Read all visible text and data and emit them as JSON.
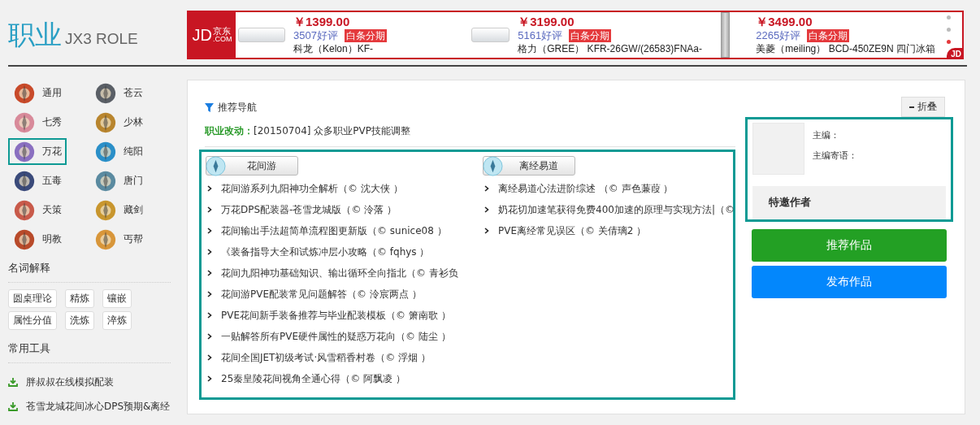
{
  "header": {
    "title": "职业",
    "subtitle": "JX3 ROLE"
  },
  "ad": {
    "logo_main": "JD",
    "logo_cn": "京东",
    "logo_com": ".COM",
    "corner": "JD",
    "items": [
      {
        "price": "￥1399.00",
        "reviews": "3507好评",
        "badge": "白条分期",
        "name": "科龙（Kelon）KF-",
        "kind": "wide"
      },
      {
        "price": "￥3199.00",
        "reviews": "5161好评",
        "badge": "白条分期",
        "name": "格力（GREE） KFR-26GW/(26583)FNAa-",
        "kind": "wide"
      },
      {
        "price": "￥3499.00",
        "reviews": "2265好评",
        "badge": "白条分期",
        "name": "美菱（meiling） BCD-450ZE9N 四门冰箱",
        "kind": "tall"
      }
    ],
    "dots": [
      {
        "selected": false
      },
      {
        "selected": false
      },
      {
        "selected": true
      }
    ]
  },
  "classes": [
    {
      "label": "通用",
      "selected": false
    },
    {
      "label": "苍云",
      "selected": false
    },
    {
      "label": "七秀",
      "selected": false
    },
    {
      "label": "少林",
      "selected": false
    },
    {
      "label": "万花",
      "selected": true
    },
    {
      "label": "纯阳",
      "selected": false
    },
    {
      "label": "五毒",
      "selected": false
    },
    {
      "label": "唐门",
      "selected": false
    },
    {
      "label": "天策",
      "selected": false
    },
    {
      "label": "藏剑",
      "selected": false
    },
    {
      "label": "明教",
      "selected": false
    },
    {
      "label": "丐帮",
      "selected": false
    }
  ],
  "glossary": {
    "title": "名词解释",
    "tags": [
      "圆桌理论",
      "精炼",
      "镶嵌",
      "属性分值",
      "洗炼",
      "淬炼"
    ]
  },
  "tools": {
    "title": "常用工具",
    "items": [
      "胖叔叔在线模拟配装",
      "苍雪龙城花间冰心DPS预期&离经"
    ]
  },
  "nav": {
    "title": "推荐导航",
    "notice_label": "职业改动：",
    "notice_text": "[20150704] 众多职业PVP技能调整"
  },
  "columns": [
    {
      "name": "花间游",
      "articles": [
        "花间游系列九阳神功全解析（© 沈大侠 ）",
        "万花DPS配装器-苍雪龙城版（© 泠落 ）",
        "花间输出手法超简单流程图更新版（© sunice08 ）",
        "《装备指导大全和试炼冲层小攻略（© fqhys ）",
        "花间九阳神功基础知识、输出循环全向指北（© 青衫负",
        "花间游PVE配装常见问题解答（© 泠宸两点 ）",
        "PVE花间新手装备推荐与毕业配装模板（© 箫南歌 ）",
        "一贴解答所有PVE硬件属性的疑惑万花向（© 陆尘 ）",
        "花间全国JET初级考试·风雪稻香村卷（© 浮烟 ）",
        "25秦皇陵花间视角全通心得（© 阿飘凌 ）"
      ]
    },
    {
      "name": "离经易道",
      "articles": [
        "离经易道心法进阶综述 （© 声色蒹葭 ）",
        "奶花切加速笔获得免费400加速的原理与实现方法|（©",
        "PVE离经常见误区（© 关倩璃2 ）"
      ]
    }
  ],
  "side": {
    "collapse": "折叠",
    "editor_label": "主编：",
    "editor_note_label": "主编寄语：",
    "guest_title": "特邀作者",
    "buttons": [
      {
        "label": "推荐作品",
        "kind": "primary"
      },
      {
        "label": "发布作品",
        "kind": "info"
      }
    ]
  }
}
